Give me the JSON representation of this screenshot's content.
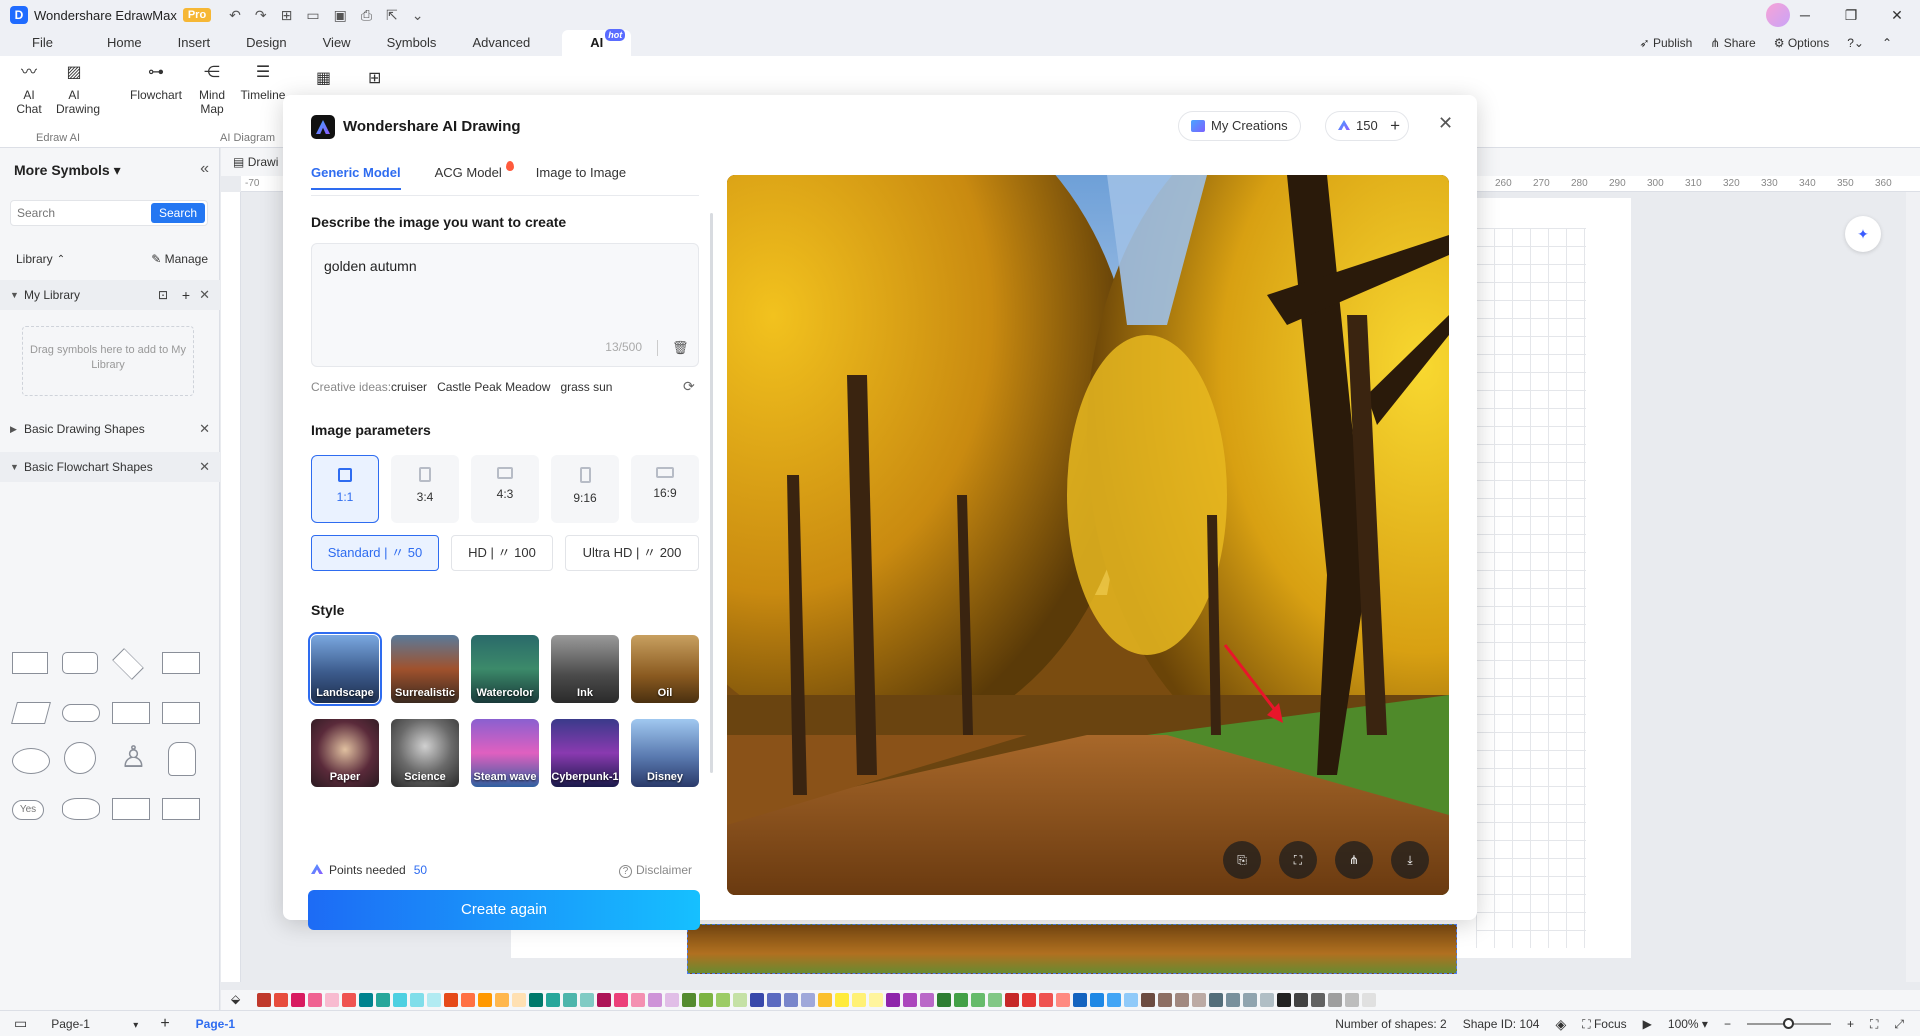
{
  "app": {
    "title": "Wondershare EdrawMax",
    "badge": "Pro"
  },
  "menu": {
    "items": [
      "File",
      "Home",
      "Insert",
      "Design",
      "View",
      "Symbols",
      "Advanced",
      "AI"
    ],
    "ai_hot": "hot",
    "right": {
      "publish": "Publish",
      "share": "Share",
      "options": "Options"
    }
  },
  "ribbon": {
    "ai_chat": "AI Chat",
    "ai_drawing": "AI Drawing",
    "edraw_ai": "Edraw AI",
    "flowchart": "Flowchart",
    "mind_map": "Mind Map",
    "timeline": "Timeline",
    "ai_diagram": "AI Diagram"
  },
  "left_panel": {
    "title": "More Symbols",
    "search_placeholder": "Search",
    "search_button": "Search",
    "library": "Library",
    "manage": "Manage",
    "my_library": "My Library",
    "drop_hint": "Drag symbols here to add to My Library",
    "basic_drawing": "Basic Drawing Shapes",
    "basic_flowchart": "Basic Flowchart Shapes",
    "yes_shape": "Yes"
  },
  "canvas": {
    "tab": "Drawi",
    "ruler_left_start": "-70",
    "ruler_ticks": [
      "260",
      "270",
      "280",
      "290",
      "300",
      "310",
      "320",
      "330",
      "340",
      "350",
      "360"
    ]
  },
  "status": {
    "page_select": "Page-1",
    "page_tab": "Page-1",
    "shapes": "Number of shapes: 2",
    "shape_id": "Shape ID: 104",
    "focus": "Focus",
    "zoom": "100%"
  },
  "modal": {
    "title": "Wondershare AI Drawing",
    "my_creations": "My Creations",
    "points": "150",
    "tabs": [
      "Generic Model",
      "ACG Model",
      "Image to Image"
    ],
    "describe_title": "Describe the image you want to create",
    "prompt": "golden autumn",
    "prompt_count": "13/500",
    "ideas_label": "Creative ideas:",
    "ideas": [
      "cruiser",
      "Castle Peak Meadow",
      "grass sun"
    ],
    "params_title": "Image parameters",
    "ratios": [
      "1:1",
      "3:4",
      "4:3",
      "9:16",
      "16:9"
    ],
    "quality": {
      "standard": "Standard",
      "standard_cost": "50",
      "hd": "HD",
      "hd_cost": "100",
      "ultra": "Ultra HD",
      "ultra_cost": "200"
    },
    "style_title": "Style",
    "styles": [
      "Landscape",
      "Surrealistic",
      "Watercolor",
      "Ink",
      "Oil",
      "Paper",
      "Science",
      "Steam wave",
      "Cyberpunk-1",
      "Disney"
    ],
    "points_needed_label": "Points needed",
    "points_needed_value": "50",
    "disclaimer": "Disclaimer",
    "create_again": "Create again"
  }
}
